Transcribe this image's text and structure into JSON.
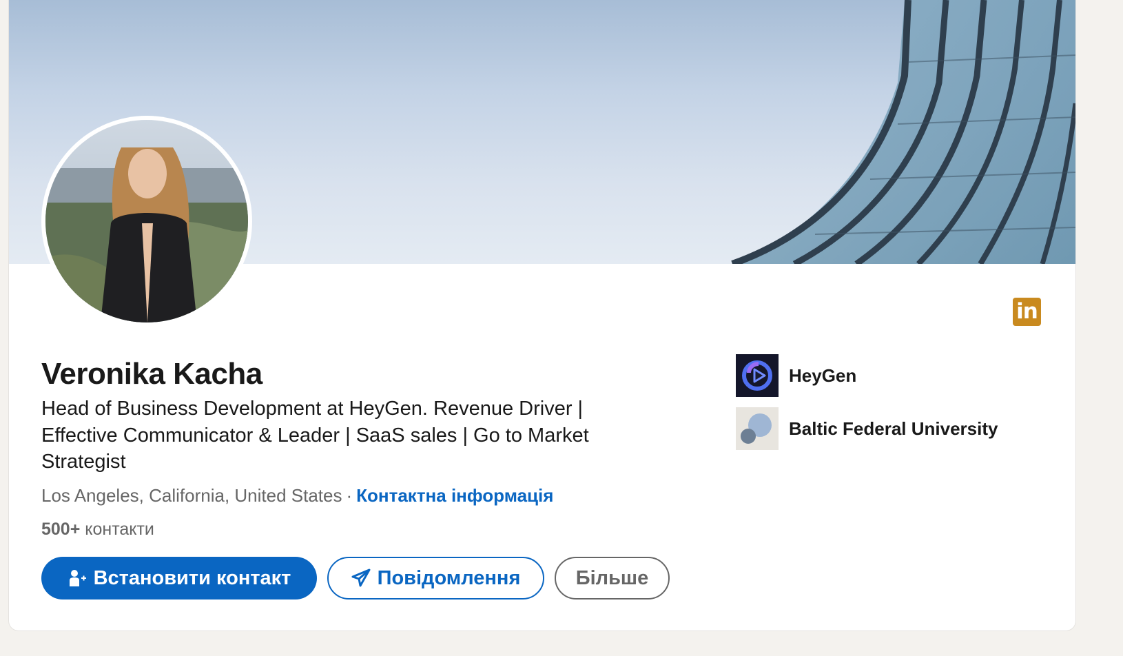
{
  "profile": {
    "name": "Veronika Kacha",
    "headline": "Head of Business Development at HeyGen. Revenue Driver | Effective Communicator & Leader | SaaS sales | Go to Market Strategist",
    "location": "Los Angeles, California, United States",
    "separator": "·",
    "contact_info_label": "Контактна інформація",
    "connections_count": "500+",
    "connections_label": "контакти"
  },
  "actions": {
    "connect_label": "Встановити контакт",
    "message_label": "Повідомлення",
    "more_label": "Більше"
  },
  "brand": {
    "badge_text": "in",
    "badge_color": "#c98a1f"
  },
  "organizations": [
    {
      "name": "HeyGen",
      "logo_icon": "heygen-logo-icon"
    },
    {
      "name": "Baltic Federal University",
      "logo_icon": "university-logo-icon"
    }
  ],
  "colors": {
    "primary": "#0a66c2",
    "text": "#191919",
    "muted": "#666666"
  },
  "icons": {
    "connect": "add-person-icon",
    "message": "paper-plane-icon"
  }
}
